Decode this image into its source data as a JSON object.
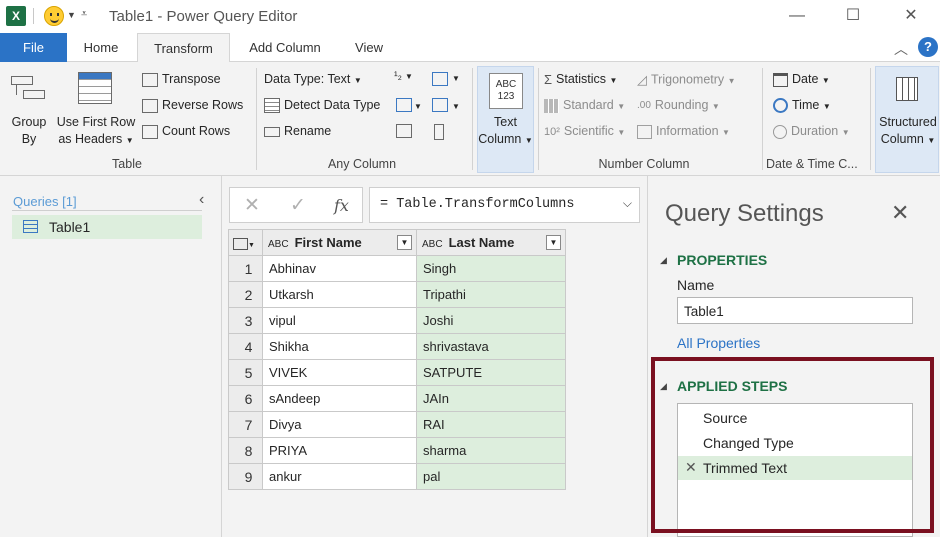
{
  "window": {
    "app_logo": "X",
    "title": "Table1 - Power Query Editor",
    "minimize": "—",
    "maximize": "☐",
    "close": "✕"
  },
  "tabs": [
    {
      "label": "File"
    },
    {
      "label": "Home"
    },
    {
      "label": "Transform"
    },
    {
      "label": "Add Column"
    },
    {
      "label": "View"
    }
  ],
  "help": "?",
  "ribbon": {
    "table": {
      "group_by_1": "Group",
      "group_by_2": "By",
      "first_row_1": "Use First Row",
      "first_row_2": "as Headers",
      "transpose": "Transpose",
      "reverse_rows": "Reverse Rows",
      "count_rows": "Count Rows",
      "label": "Table"
    },
    "any_column": {
      "data_type": "Data Type: Text",
      "detect": "Detect Data Type",
      "rename": "Rename",
      "label": "Any Column"
    },
    "text_column": {
      "icon_text_1": "ABC",
      "icon_text_2": "123",
      "label_1": "Text",
      "label_2": "Column"
    },
    "number_column": {
      "statistics": "Statistics",
      "standard": "Standard",
      "scientific": "Scientific",
      "trigonometry": "Trigonometry",
      "rounding": "Rounding",
      "information": "Information",
      "label": "Number Column"
    },
    "datetime": {
      "date": "Date",
      "time": "Time",
      "duration": "Duration",
      "label": "Date & Time C..."
    },
    "structured": {
      "label_1": "Structured",
      "label_2": "Column"
    }
  },
  "queries": {
    "header": "Queries [1]",
    "items": [
      {
        "label": "Table1"
      }
    ]
  },
  "formula_bar": {
    "formula": "= Table.TransformColumns"
  },
  "grid": {
    "columns": [
      "First Name",
      "Last Name"
    ],
    "rows": [
      {
        "n": "1",
        "first": "Abhinav",
        "last": "Singh"
      },
      {
        "n": "2",
        "first": "Utkarsh",
        "last": "Tripathi"
      },
      {
        "n": "3",
        "first": "vipul",
        "last": "Joshi"
      },
      {
        "n": "4",
        "first": "Shikha",
        "last": "shrivastava"
      },
      {
        "n": "5",
        "first": "VIVEK",
        "last": "SATPUTE"
      },
      {
        "n": "6",
        "first": "sAndeep",
        "last": "JAIn"
      },
      {
        "n": "7",
        "first": "Divya",
        "last": "RAI"
      },
      {
        "n": "8",
        "first": "PRIYA",
        "last": "sharma"
      },
      {
        "n": "9",
        "first": "ankur",
        "last": "pal"
      }
    ]
  },
  "settings": {
    "title": "Query Settings",
    "properties_header": "PROPERTIES",
    "name_label": "Name",
    "name_value": "Table1",
    "all_properties": "All Properties",
    "applied_steps_header": "APPLIED STEPS",
    "steps": [
      {
        "label": "Source"
      },
      {
        "label": "Changed Type"
      },
      {
        "label": "Trimmed Text"
      }
    ]
  },
  "colors": {
    "accent": "#2b73c6",
    "section_green": "#1e7145",
    "selection_green": "#ddeedd",
    "highlight_box": "#7a1020"
  }
}
